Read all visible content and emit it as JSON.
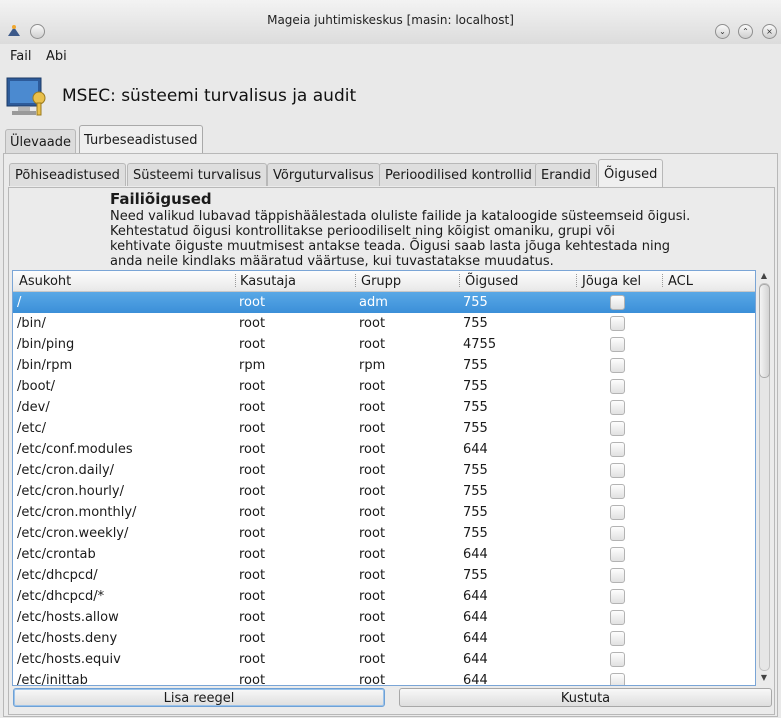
{
  "window": {
    "title": "Mageia juhtimiskeskus  [masin: localhost]"
  },
  "menu": {
    "items": [
      "Fail",
      "Abi"
    ]
  },
  "header": {
    "title": "MSEC: süsteemi turvalisus ja audit"
  },
  "main_tabs": [
    {
      "label": "Ülevaade",
      "active": false
    },
    {
      "label": "Turbeseadistused",
      "active": true
    }
  ],
  "sub_tabs": [
    {
      "label": "Põhiseadistused",
      "active": false
    },
    {
      "label": "Süsteemi turvalisus",
      "active": false
    },
    {
      "label": "Võrguturvalisus",
      "active": false
    },
    {
      "label": "Perioodilised kontrollid",
      "active": false
    },
    {
      "label": "Erandid",
      "active": false
    },
    {
      "label": "Õigused",
      "active": true
    }
  ],
  "section": {
    "title": "Failiõigused",
    "description_lines": [
      "Need valikud lubavad täppishäälestada oluliste failide ja kataloogide süsteemseid õigusi.",
      "Kehtestatud õigusi kontrollitakse perioodiliselt ning kõigist omaniku, grupi või",
      "kehtivate õiguste muutmisest antakse teada. Õigusi saab lasta jõuga kehtestada ning",
      "anda neile kindlaks määratud väärtuse, kui tuvastatakse muudatus."
    ]
  },
  "table": {
    "columns": [
      "Asukoht",
      "Kasutaja",
      "Grupp",
      "Õigused",
      "Jõuga kel",
      "ACL"
    ],
    "rows": [
      {
        "path": "/",
        "user": "root",
        "group": "adm",
        "perm": "755",
        "force": false,
        "selected": true
      },
      {
        "path": "/bin/",
        "user": "root",
        "group": "root",
        "perm": "755",
        "force": false
      },
      {
        "path": "/bin/ping",
        "user": "root",
        "group": "root",
        "perm": "4755",
        "force": false
      },
      {
        "path": "/bin/rpm",
        "user": "rpm",
        "group": "rpm",
        "perm": "755",
        "force": false
      },
      {
        "path": "/boot/",
        "user": "root",
        "group": "root",
        "perm": "755",
        "force": false
      },
      {
        "path": "/dev/",
        "user": "root",
        "group": "root",
        "perm": "755",
        "force": false
      },
      {
        "path": "/etc/",
        "user": "root",
        "group": "root",
        "perm": "755",
        "force": false
      },
      {
        "path": "/etc/conf.modules",
        "user": "root",
        "group": "root",
        "perm": "644",
        "force": false
      },
      {
        "path": "/etc/cron.daily/",
        "user": "root",
        "group": "root",
        "perm": "755",
        "force": false
      },
      {
        "path": "/etc/cron.hourly/",
        "user": "root",
        "group": "root",
        "perm": "755",
        "force": false
      },
      {
        "path": "/etc/cron.monthly/",
        "user": "root",
        "group": "root",
        "perm": "755",
        "force": false
      },
      {
        "path": "/etc/cron.weekly/",
        "user": "root",
        "group": "root",
        "perm": "755",
        "force": false
      },
      {
        "path": "/etc/crontab",
        "user": "root",
        "group": "root",
        "perm": "644",
        "force": false
      },
      {
        "path": "/etc/dhcpcd/",
        "user": "root",
        "group": "root",
        "perm": "755",
        "force": false
      },
      {
        "path": "/etc/dhcpcd/*",
        "user": "root",
        "group": "root",
        "perm": "644",
        "force": false
      },
      {
        "path": "/etc/hosts.allow",
        "user": "root",
        "group": "root",
        "perm": "644",
        "force": false
      },
      {
        "path": "/etc/hosts.deny",
        "user": "root",
        "group": "root",
        "perm": "644",
        "force": false
      },
      {
        "path": "/etc/hosts.equiv",
        "user": "root",
        "group": "root",
        "perm": "644",
        "force": false
      },
      {
        "path": "/etc/inittab",
        "user": "root",
        "group": "root",
        "perm": "644",
        "force": false
      }
    ]
  },
  "buttons": {
    "add": "Lisa reegel",
    "delete": "Kustuta"
  },
  "colors": {
    "selection": "#3b8fd8",
    "accent": "#7aa5d6"
  },
  "icons": {
    "app": "mageia-star-icon",
    "logo": "security-monitor-icon"
  }
}
